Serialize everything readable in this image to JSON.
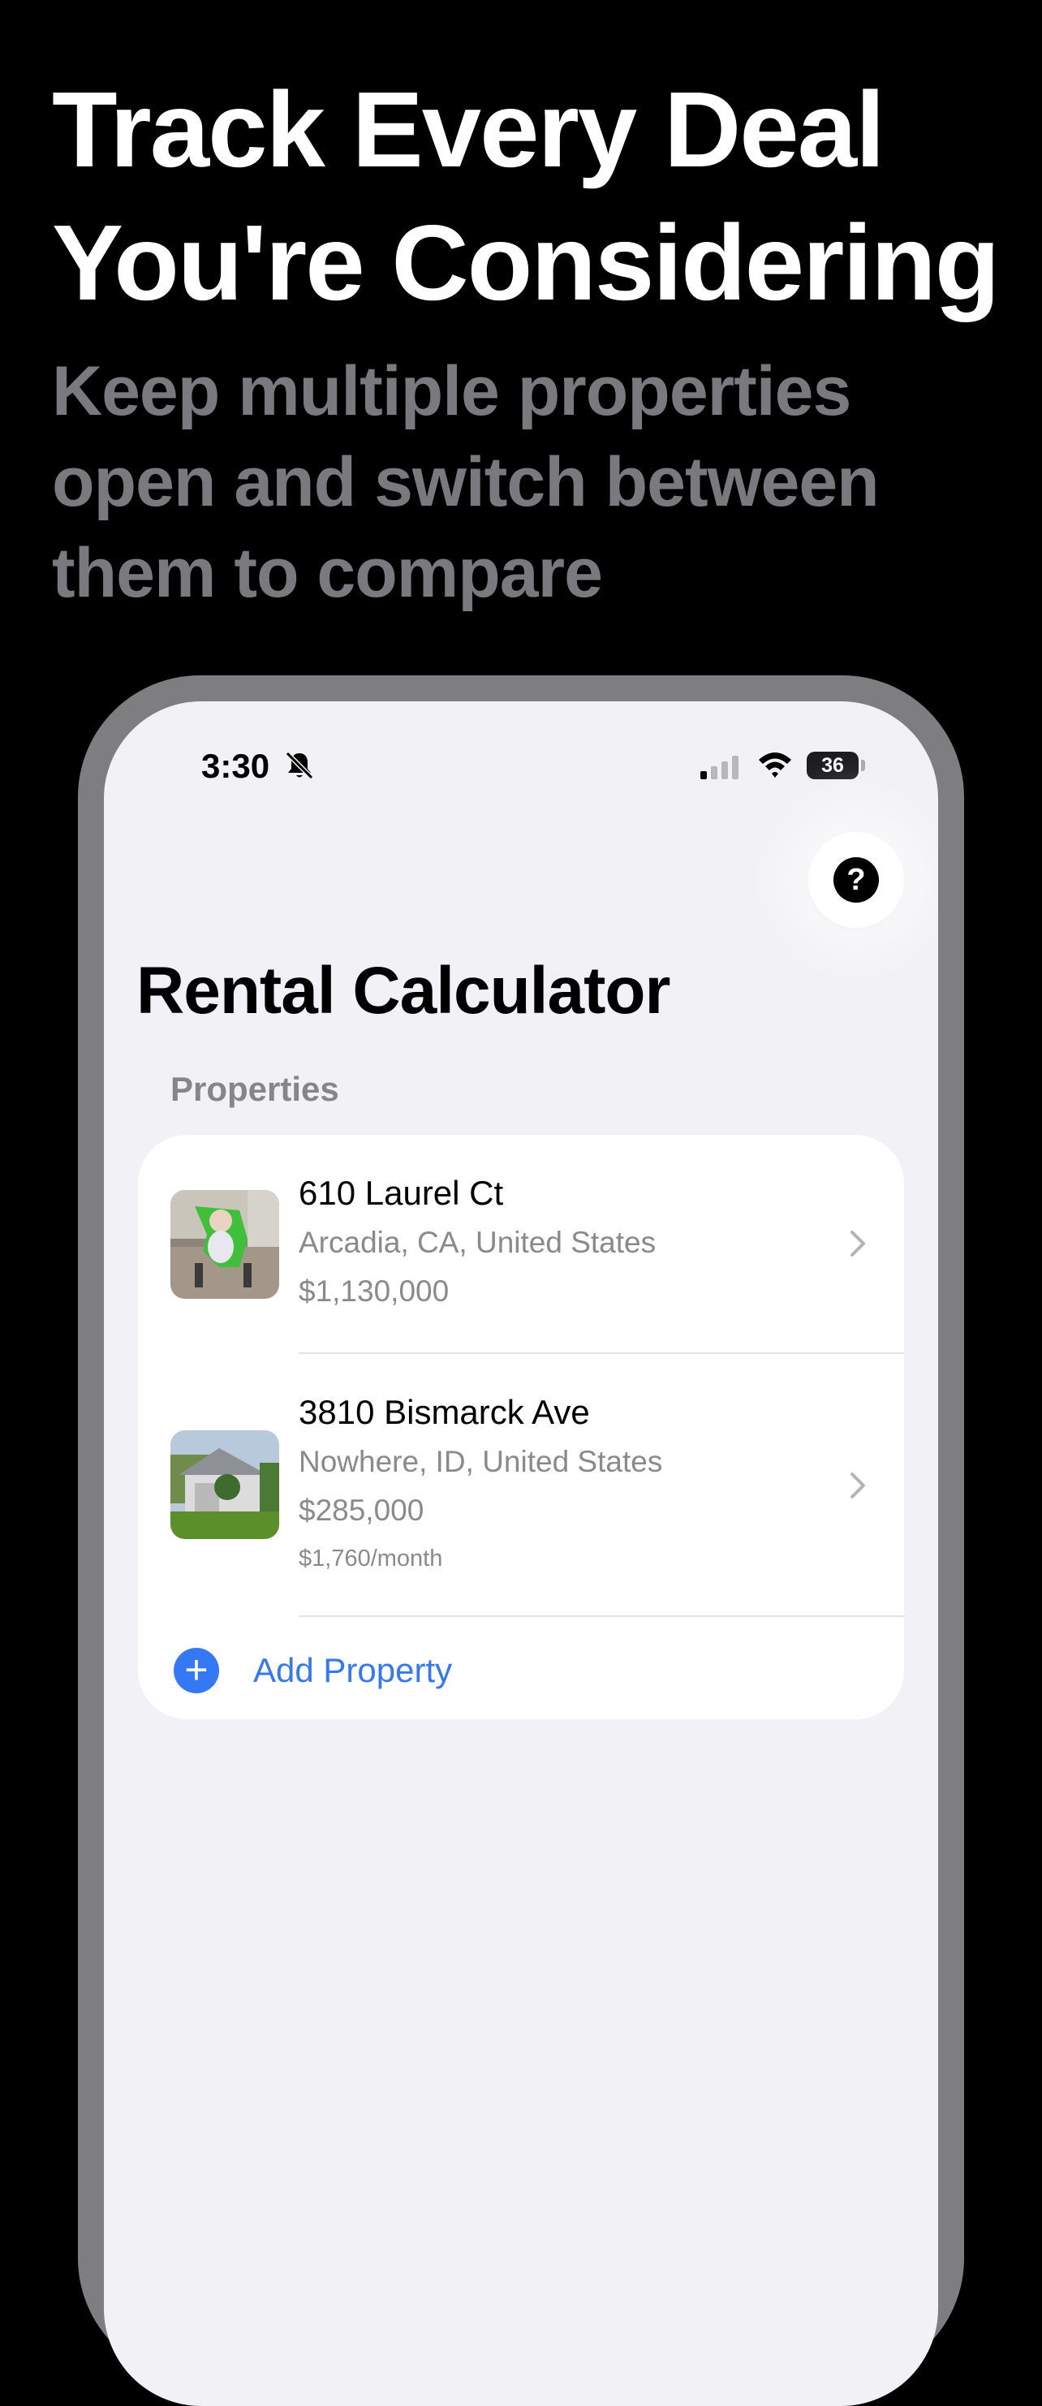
{
  "promo": {
    "headline_line1": "Track Every Deal",
    "headline_line2": "You're Considering",
    "subhead_line1": "Keep multiple properties",
    "subhead_line2": "open and switch between",
    "subhead_line3": "them to compare"
  },
  "status_bar": {
    "time": "3:30",
    "battery": "36",
    "icons": [
      "bell-slash-icon",
      "cellular-signal-icon",
      "wifi-icon",
      "battery-icon"
    ]
  },
  "app": {
    "title": "Rental Calculator",
    "help_label": "?",
    "section_label": "Properties",
    "properties": [
      {
        "address": "610 Laurel Ct",
        "location": "Arcadia, CA, United States",
        "price": "$1,130,000"
      },
      {
        "address": "3810 Bismarck Ave",
        "location": "Nowhere, ID, United States",
        "price": "$285,000",
        "rent": "$1,760/month"
      }
    ],
    "add_label": "Add Property",
    "add_icon": "+"
  },
  "colors": {
    "accent": "#3478f6",
    "background": "#f1f1f6",
    "frame": "#7e7e81"
  }
}
